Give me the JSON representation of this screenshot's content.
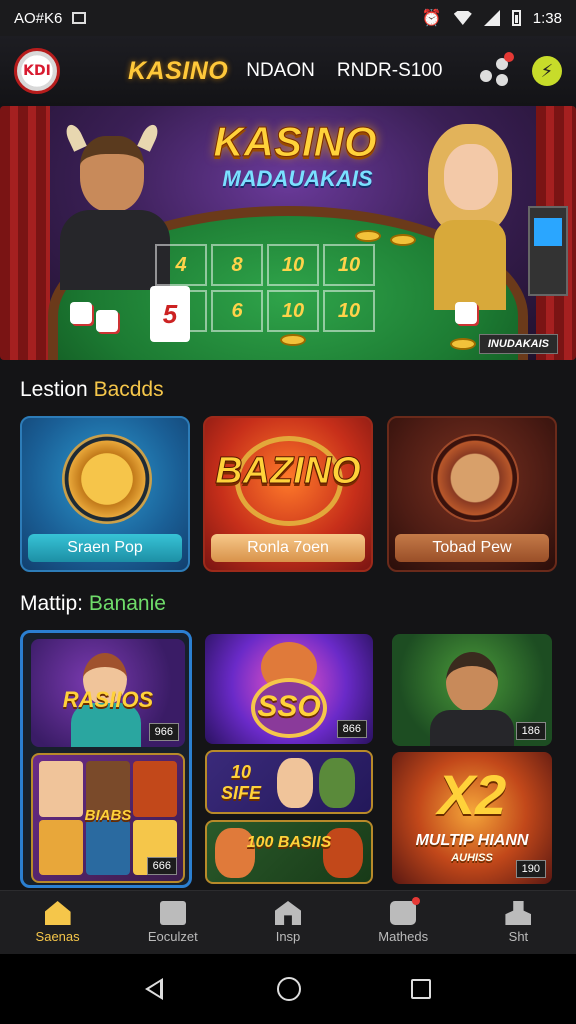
{
  "status_bar": {
    "left_text": "AO#K6",
    "time": "1:38"
  },
  "header": {
    "logo_text": "KDI",
    "brand": "KASINO",
    "link1": "NDAON",
    "link2": "RNDR-S100"
  },
  "hero": {
    "title": "KASINO",
    "subtitle": "MADAUAKAIS",
    "badge": "INUDAKAIS",
    "table_numbers": [
      "4",
      "8",
      "10",
      "10",
      "5",
      "6",
      "10",
      "10"
    ]
  },
  "section1": {
    "title_part1": "Lestion",
    "title_part2": "Bacdds"
  },
  "featured": [
    {
      "button_label": "Sraen Pop"
    },
    {
      "title": "BAZINO",
      "button_label": "Ronla 7oen"
    },
    {
      "button_label": "Tobad Pew"
    }
  ],
  "section2": {
    "title_part1": "Mattip:",
    "title_part2": "Bananie"
  },
  "games": {
    "col1_top": {
      "title": "RASIIOS",
      "badge": "966"
    },
    "col1_bottom": {
      "title": "BIABS",
      "badge": "666"
    },
    "col2_top": {
      "title": "SSO",
      "badge": "866"
    },
    "col2_mid": {
      "title": "10 SIFE"
    },
    "col2_bottom": {
      "title": "100 BASIIS"
    },
    "col3_top": {
      "badge": "186"
    },
    "col3_bottom": {
      "title": "X2",
      "subtitle": "MULTIP HIANN",
      "caption": "AUHISS",
      "badge": "190"
    }
  },
  "bottom_nav": [
    {
      "label": "Saenas",
      "icon": "home-icon",
      "active": true
    },
    {
      "label": "Eoculzet",
      "icon": "document-icon",
      "active": false
    },
    {
      "label": "Insp",
      "icon": "house-icon",
      "active": false
    },
    {
      "label": "Matheds",
      "icon": "gamepad-icon",
      "active": false
    },
    {
      "label": "Sht",
      "icon": "people-icon",
      "active": false
    }
  ],
  "colors": {
    "accent": "#f5c64a",
    "background": "#141416",
    "highlight_green": "#6fdc6a",
    "active_border": "#2b7fd1"
  }
}
